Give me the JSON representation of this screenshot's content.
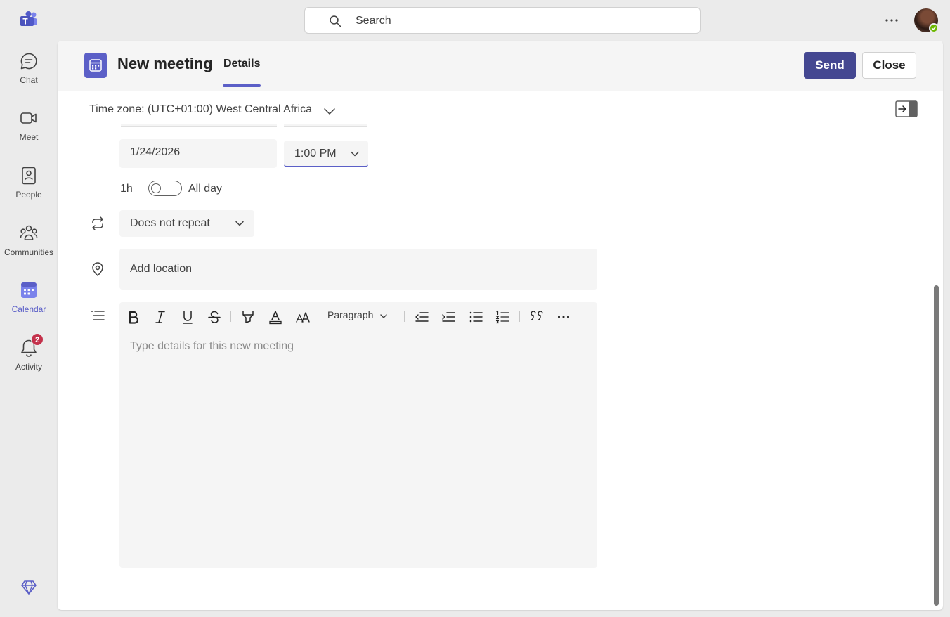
{
  "rail": {
    "items": [
      {
        "label": "Chat",
        "icon": "chat-icon"
      },
      {
        "label": "Meet",
        "icon": "video-icon"
      },
      {
        "label": "People",
        "icon": "people-icon"
      },
      {
        "label": "Communities",
        "icon": "communities-icon"
      },
      {
        "label": "Calendar",
        "icon": "calendar-icon",
        "active": true
      },
      {
        "label": "Activity",
        "icon": "bell-icon",
        "badge": "2"
      }
    ]
  },
  "search": {
    "placeholder": "Search"
  },
  "meeting": {
    "title": "New meeting",
    "tab": "Details",
    "send_label": "Send",
    "close_label": "Close",
    "timezone": "Time zone: (UTC+01:00) West Central Africa",
    "end_date": "1/24/2026",
    "end_time": "1:00 PM",
    "duration": "1h",
    "all_day_label": "All day",
    "all_day_on": false,
    "repeat": "Does not repeat",
    "location_placeholder": "Add location",
    "details_placeholder": "Type details for this new meeting",
    "paragraph_style": "Paragraph"
  },
  "colors": {
    "accent": "#5b5fc7",
    "send_button": "#444791",
    "badge": "#c4314b",
    "presence": "#6bb700"
  }
}
